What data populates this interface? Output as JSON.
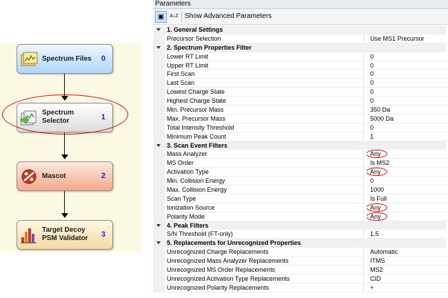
{
  "workflow": {
    "nodes": [
      {
        "label": "Spectrum Files",
        "num": "0",
        "icon": "spectrum-files-icon"
      },
      {
        "label": "Spectrum\nSelector",
        "num": "1",
        "icon": "spectrum-selector-icon"
      },
      {
        "label": "Mascot",
        "num": "2",
        "icon": "mascot-icon"
      },
      {
        "label": "Target Decoy\nPSM Validator",
        "num": "3",
        "icon": "psm-validator-icon"
      }
    ]
  },
  "panel": {
    "title": "Parameters",
    "toolbar": {
      "categorized_label": "▣",
      "az_label": "A↓Z",
      "advanced_label": "Show Advanced Parameters"
    },
    "rows": [
      {
        "type": "category",
        "label": "1. General Settings"
      },
      {
        "label": "Precursor Selection",
        "value": "Use MS1 Precursor"
      },
      {
        "type": "category",
        "label": "2. Spectrum Properties Filter"
      },
      {
        "label": "Lower RT Limit",
        "value": "0"
      },
      {
        "label": "Upper RT Limit",
        "value": "0"
      },
      {
        "label": "First Scan",
        "value": "0"
      },
      {
        "label": "Last Scan",
        "value": "0"
      },
      {
        "label": "Lowest Charge State",
        "value": "0"
      },
      {
        "label": "Highest Charge State",
        "value": "0"
      },
      {
        "label": "Min. Precursor Mass",
        "value": "350 Da"
      },
      {
        "label": "Max. Precursor Mass",
        "value": "5000 Da"
      },
      {
        "label": "Total Intensity Threshold",
        "value": "0"
      },
      {
        "label": "Minimum Peak Count",
        "value": "1"
      },
      {
        "type": "category",
        "label": "3. Scan Event Filters"
      },
      {
        "label": "Mass Analyzer",
        "value": "Any",
        "circled": true
      },
      {
        "label": "MS Order",
        "value": "Is MS2"
      },
      {
        "label": "Activation Type",
        "value": "Any",
        "circled": true
      },
      {
        "label": "Min. Collision Energy",
        "value": "0"
      },
      {
        "label": "Max. Collision Energy",
        "value": "1000"
      },
      {
        "label": "Scan Type",
        "value": "Is Full"
      },
      {
        "label": "Ionization Source",
        "value": "Any",
        "circled": true
      },
      {
        "label": "Polarity Mode",
        "value": "Any",
        "circled": true
      },
      {
        "type": "category",
        "label": "4. Peak Filters"
      },
      {
        "label": "S/N Threshold (FT-only)",
        "value": "1.5"
      },
      {
        "type": "category",
        "label": "5. Replacements for Unrecognized Properties"
      },
      {
        "label": "Unrecognized Charge Replacements",
        "value": "Automatic"
      },
      {
        "label": "Unrecognized Mass Analyzer Replacements",
        "value": "ITMS"
      },
      {
        "label": "Unrecognized MS Order Replacements",
        "value": "MS2"
      },
      {
        "label": "Unrecognized Activation Type Replacements",
        "value": "CID"
      },
      {
        "label": "Unrecognized Polarity Replacements",
        "value": "+"
      }
    ]
  },
  "colors": {
    "annotation_red": "#e00000",
    "node_number_blue": "#1a1acf",
    "workflow_bg": "#fbf8e3"
  }
}
